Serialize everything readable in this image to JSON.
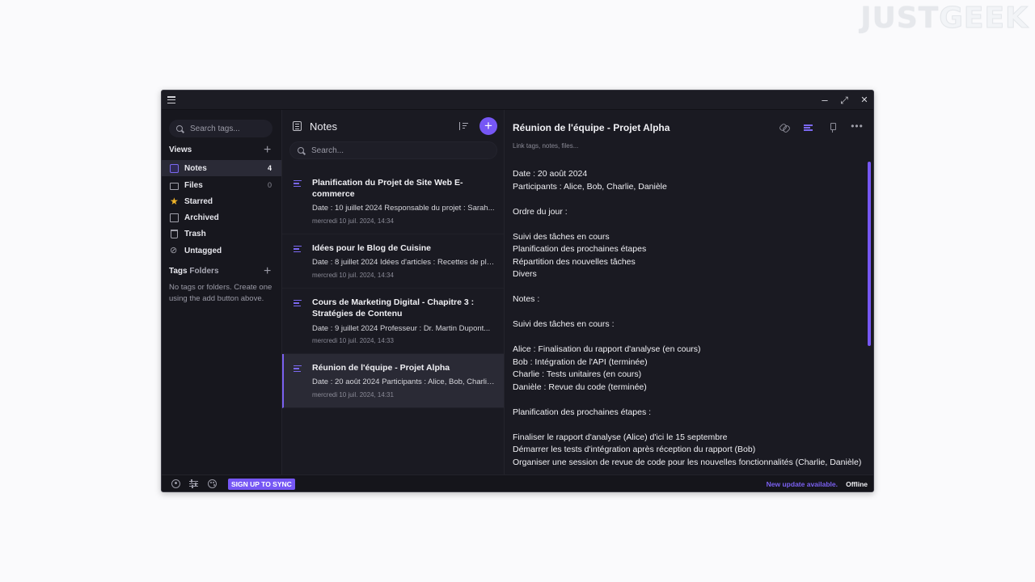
{
  "watermark": {
    "part1": "JUST",
    "part2": "GEEK"
  },
  "sidebar": {
    "search_placeholder": "Search tags...",
    "views_heading": "Views",
    "views": [
      {
        "label": "Notes",
        "count": "4",
        "icon": "notes-icon"
      },
      {
        "label": "Files",
        "count": "0",
        "icon": "folder-icon"
      },
      {
        "label": "Starred",
        "icon": "star-icon"
      },
      {
        "label": "Archived",
        "icon": "archive-icon"
      },
      {
        "label": "Trash",
        "icon": "trash-icon"
      },
      {
        "label": "Untagged",
        "icon": "untagged-icon"
      }
    ],
    "tags_heading": "Tags",
    "folders_heading": "Folders",
    "empty_message": "No tags or folders. Create one using the add button above."
  },
  "notes_list": {
    "title": "Notes",
    "add_label": "+",
    "search_placeholder": "Search...",
    "items": [
      {
        "title": "Planification du Projet de Site Web E-commerce",
        "excerpt": "Date : 10 juillet 2024 Responsable du projet : Sarah...",
        "date": "mercredi 10 juil. 2024, 14:34"
      },
      {
        "title": "Idées pour le Blog de Cuisine",
        "excerpt": "Date : 8 juillet 2024 Idées d'articles : Recettes de pla...",
        "date": "mercredi 10 juil. 2024, 14:34"
      },
      {
        "title": "Cours de Marketing Digital - Chapitre 3 : Stratégies de Contenu",
        "excerpt": "Date : 9 juillet 2024 Professeur : Dr. Martin Dupont...",
        "date": "mercredi 10 juil. 2024, 14:33"
      },
      {
        "title": "Réunion de l'équipe - Projet Alpha",
        "excerpt": "Date : 20 août 2024 Participants : Alice, Bob, Charlie...",
        "date": "mercredi 10 juil. 2024, 14:31"
      }
    ]
  },
  "editor": {
    "title": "Réunion de l'équipe - Projet Alpha",
    "tags_placeholder": "Link tags, notes, files...",
    "more_label": "•••",
    "lines": [
      "Date : 20 août 2024",
      "Participants : Alice, Bob, Charlie, Danièle",
      "",
      "Ordre du jour :",
      "",
      "Suivi des tâches en cours",
      "Planification des prochaines étapes",
      "Répartition des nouvelles tâches",
      "Divers",
      "",
      "Notes :",
      "",
      "Suivi des tâches en cours :",
      "",
      "Alice : Finalisation du rapport d'analyse (en cours)",
      "Bob : Intégration de l'API (terminée)",
      "Charlie : Tests unitaires (en cours)",
      "Danièle : Revue du code (terminée)",
      "",
      "Planification des prochaines étapes :",
      "",
      "Finaliser le rapport d'analyse (Alice) d'ici le 15 septembre",
      "Démarrer les tests d'intégration après réception du rapport (Bob)",
      "Organiser une session de revue de code pour les nouvelles fonctionnalités (Charlie, Danièle)"
    ]
  },
  "statusbar": {
    "signup_label": "SIGN UP TO SYNC",
    "update_label": "New update available.",
    "status_label": "Offline"
  },
  "window_controls": {
    "minimize": "–",
    "maximize": "⤢",
    "close": "✕"
  },
  "colors": {
    "accent": "#7657f5",
    "background": "#1a1a22",
    "sidebar": "#17171e",
    "star": "#f0b429"
  }
}
